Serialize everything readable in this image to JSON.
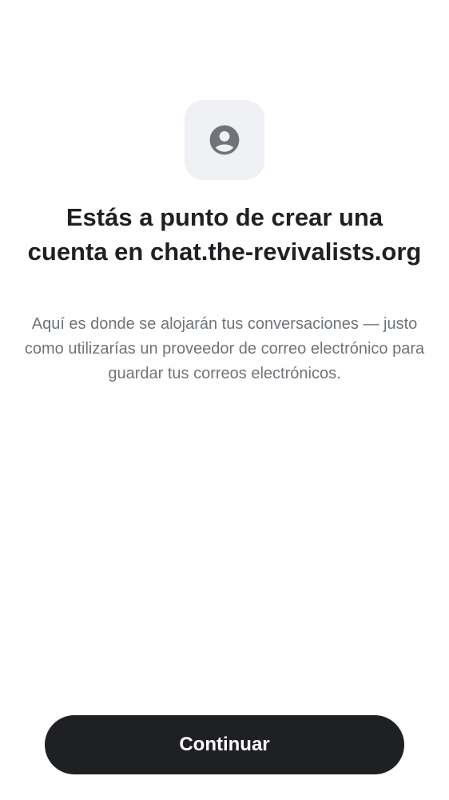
{
  "onboarding": {
    "icon": "user-circle-icon",
    "title": "Estás a punto de crear una cuenta en chat.the-revivalists.org",
    "description": "Aquí es donde se alojarán tus conversaciones — justo como utilizarías un proveedor de correo electrónico para guardar tus correos electrónicos.",
    "continue_label": "Continuar"
  },
  "colors": {
    "background": "#ffffff",
    "icon_tile": "#f0f1f5",
    "icon": "#6f7479",
    "heading_text": "#1f2023",
    "body_text": "#6f7479",
    "button_background": "#1f2023",
    "button_text": "#ffffff"
  }
}
